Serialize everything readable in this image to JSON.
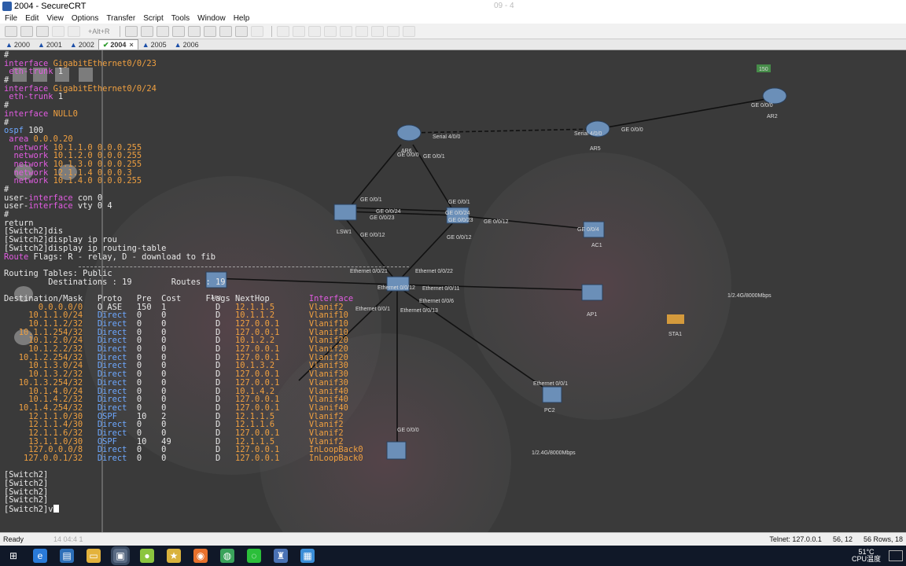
{
  "window": {
    "title": "2004 - SecureCRT",
    "ghost_text": "09 - 4"
  },
  "menu": [
    "File",
    "Edit",
    "View",
    "Options",
    "Transfer",
    "Script",
    "Tools",
    "Window",
    "Help"
  ],
  "toolbar": {
    "hint": "+Alt+R"
  },
  "tabs": [
    {
      "label": "2000",
      "state": "warn"
    },
    {
      "label": "2001",
      "state": "warn"
    },
    {
      "label": "2002",
      "state": "warn"
    },
    {
      "label": "2004",
      "state": "active"
    },
    {
      "label": "2005",
      "state": "warn"
    },
    {
      "label": "2006",
      "state": "warn"
    }
  ],
  "terminal": {
    "pre_lines": [
      [
        [
          "#",
          "w"
        ]
      ],
      [
        [
          "interface ",
          "kw"
        ],
        [
          "GigabitEthernet0/0/23",
          "or"
        ]
      ],
      [
        [
          " eth-trunk ",
          "kw"
        ],
        [
          "1",
          "w"
        ]
      ],
      [
        [
          "#",
          "w"
        ]
      ],
      [
        [
          "interface ",
          "kw"
        ],
        [
          "GigabitEthernet0/0/24",
          "or"
        ]
      ],
      [
        [
          " eth-trunk ",
          "kw"
        ],
        [
          "1",
          "w"
        ]
      ],
      [
        [
          "#",
          "w"
        ]
      ],
      [
        [
          "interface ",
          "kw"
        ],
        [
          "NULL0",
          "or"
        ]
      ],
      [
        [
          "#",
          "w"
        ]
      ],
      [
        [
          "ospf ",
          "bl"
        ],
        [
          "100",
          "w"
        ]
      ],
      [
        [
          " area ",
          "kw"
        ],
        [
          "0.0.0.20",
          "or"
        ]
      ],
      [
        [
          "  network ",
          "kw"
        ],
        [
          "10.1.1.0 0.0.0.255",
          "or"
        ]
      ],
      [
        [
          "  network ",
          "kw"
        ],
        [
          "10.1.2.0 0.0.0.255",
          "or"
        ]
      ],
      [
        [
          "  network ",
          "kw"
        ],
        [
          "10.1.3.0 0.0.0.255",
          "or"
        ]
      ],
      [
        [
          "  network ",
          "kw"
        ],
        [
          "12.1.1.4 0.0.0.3",
          "or"
        ]
      ],
      [
        [
          "  network ",
          "kw"
        ],
        [
          "10.1.4.0 0.0.0.255",
          "or"
        ]
      ],
      [
        [
          "#",
          "w"
        ]
      ],
      [
        [
          "user-",
          "w"
        ],
        [
          "interface ",
          "kw"
        ],
        [
          "con 0",
          "w"
        ]
      ],
      [
        [
          "user-",
          "w"
        ],
        [
          "interface ",
          "kw"
        ],
        [
          "vty 0 4",
          "w"
        ]
      ],
      [
        [
          "#",
          "w"
        ]
      ],
      [
        [
          "return",
          "w"
        ]
      ],
      [
        [
          "[Switch2]dis",
          "w"
        ]
      ],
      [
        [
          "[Switch2]display ip rou",
          "w"
        ]
      ],
      [
        [
          "[Switch2]display ip routing-table",
          "w"
        ]
      ],
      [
        [
          "Route",
          "kw"
        ],
        [
          " Flags: R - relay, D - download to fib",
          "w"
        ]
      ],
      [
        [
          "",
          "w"
        ]
      ],
      [
        [
          "Routing Tables: Public",
          "w"
        ]
      ],
      [
        [
          "         Destinations : 19        Routes : 19",
          "w"
        ]
      ],
      [
        [
          "",
          "w"
        ]
      ]
    ],
    "table_header": [
      "Destination/Mask",
      "Proto",
      "Pre",
      "Cost",
      "Flags",
      "NextHop",
      "Interface"
    ],
    "routes": [
      [
        "0.0.0.0/0",
        "O_ASE",
        "150",
        "1",
        "D",
        "12.1.1.5",
        "Vlanif2"
      ],
      [
        "10.1.1.0/24",
        "Direct",
        "0",
        "0",
        "D",
        "10.1.1.2",
        "Vlanif10"
      ],
      [
        "10.1.1.2/32",
        "Direct",
        "0",
        "0",
        "D",
        "127.0.0.1",
        "Vlanif10"
      ],
      [
        "10.1.1.254/32",
        "Direct",
        "0",
        "0",
        "D",
        "127.0.0.1",
        "Vlanif10"
      ],
      [
        "10.1.2.0/24",
        "Direct",
        "0",
        "0",
        "D",
        "10.1.2.2",
        "Vlanif20"
      ],
      [
        "10.1.2.2/32",
        "Direct",
        "0",
        "0",
        "D",
        "127.0.0.1",
        "Vlanif20"
      ],
      [
        "10.1.2.254/32",
        "Direct",
        "0",
        "0",
        "D",
        "127.0.0.1",
        "Vlanif20"
      ],
      [
        "10.1.3.0/24",
        "Direct",
        "0",
        "0",
        "D",
        "10.1.3.2",
        "Vlanif30"
      ],
      [
        "10.1.3.2/32",
        "Direct",
        "0",
        "0",
        "D",
        "127.0.0.1",
        "Vlanif30"
      ],
      [
        "10.1.3.254/32",
        "Direct",
        "0",
        "0",
        "D",
        "127.0.0.1",
        "Vlanif30"
      ],
      [
        "10.1.4.0/24",
        "Direct",
        "0",
        "0",
        "D",
        "10.1.4.2",
        "Vlanif40"
      ],
      [
        "10.1.4.2/32",
        "Direct",
        "0",
        "0",
        "D",
        "127.0.0.1",
        "Vlanif40"
      ],
      [
        "10.1.4.254/32",
        "Direct",
        "0",
        "0",
        "D",
        "127.0.0.1",
        "Vlanif40"
      ],
      [
        "12.1.1.0/30",
        "OSPF",
        "10",
        "2",
        "D",
        "12.1.1.5",
        "Vlanif2"
      ],
      [
        "12.1.1.4/30",
        "Direct",
        "0",
        "0",
        "D",
        "12.1.1.6",
        "Vlanif2"
      ],
      [
        "12.1.1.6/32",
        "Direct",
        "0",
        "0",
        "D",
        "127.0.0.1",
        "Vlanif2"
      ],
      [
        "13.1.1.0/30",
        "OSPF",
        "10",
        "49",
        "D",
        "12.1.1.5",
        "Vlanif2"
      ],
      [
        "127.0.0.0/8",
        "Direct",
        "0",
        "0",
        "D",
        "127.0.0.1",
        "InLoopBack0"
      ],
      [
        "127.0.0.1/32",
        "Direct",
        "0",
        "0",
        "D",
        "127.0.0.1",
        "InLoopBack0"
      ]
    ],
    "post_lines": [
      "",
      "[Switch2]",
      "[Switch2]",
      "[Switch2]",
      "[Switch2]",
      "[Switch2]v"
    ]
  },
  "status": {
    "left": "Ready",
    "ghost": "14  04:4  1",
    "connection": "Telnet: 127.0.0.1",
    "cursor_pos": "56, 12",
    "size": "56 Rows, 18"
  },
  "taskbar": {
    "temp": "51°C",
    "cpu_label": "CPU温度",
    "icons": [
      "windows-icon",
      "edge-icon",
      "store-icon",
      "folder-icon",
      "securecrt-icon",
      "huawei-icon",
      "star-icon",
      "firefox-icon",
      "chrome-icon",
      "wechat-icon",
      "ensp-icon",
      "app-icon"
    ]
  },
  "colors": {
    "keyword": "#e25ce2",
    "value": "#f0a040",
    "direct": "#6da8ff",
    "terminal_bg": "#333333"
  }
}
